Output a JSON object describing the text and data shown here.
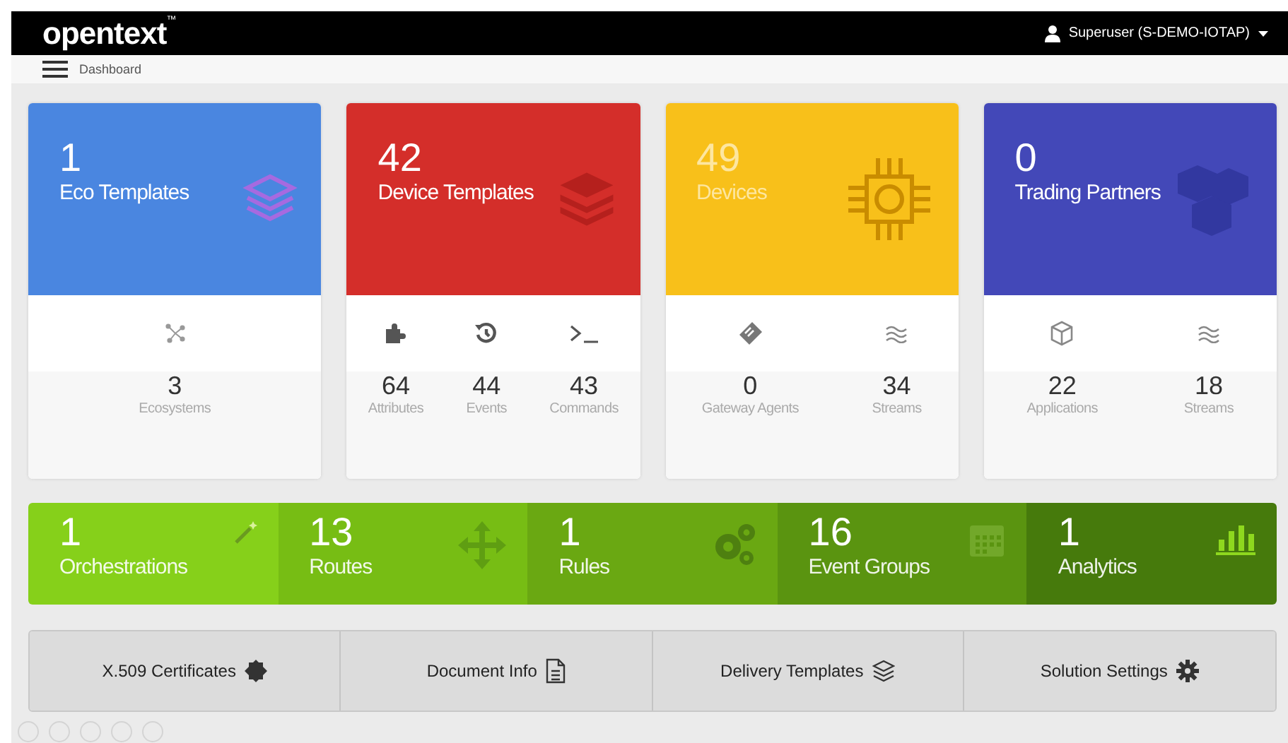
{
  "header": {
    "logo": "opentext",
    "logo_mark": "™",
    "user": "Superuser (S-DEMO-IOTAP)"
  },
  "breadcrumb": "Dashboard",
  "cards": [
    {
      "count": "1",
      "label": "Eco Templates",
      "color": "#4a86e0",
      "stats": [
        {
          "value": "3",
          "label": "Ecosystems"
        }
      ]
    },
    {
      "count": "42",
      "label": "Device Templates",
      "color": "#d42e2a",
      "stats": [
        {
          "value": "64",
          "label": "Attributes"
        },
        {
          "value": "44",
          "label": "Events"
        },
        {
          "value": "43",
          "label": "Commands"
        }
      ]
    },
    {
      "count": "49",
      "label": "Devices",
      "color": "#f8c01a",
      "stats": [
        {
          "value": "0",
          "label": "Gateway Agents"
        },
        {
          "value": "34",
          "label": "Streams"
        }
      ]
    },
    {
      "count": "0",
      "label": "Trading Partners",
      "color": "#4348b8",
      "stats": [
        {
          "value": "22",
          "label": "Applications"
        },
        {
          "value": "18",
          "label": "Streams"
        }
      ]
    }
  ],
  "tiles": [
    {
      "count": "1",
      "label": "Orchestrations",
      "color": "#86d01a"
    },
    {
      "count": "13",
      "label": "Routes",
      "color": "#77bd14"
    },
    {
      "count": "1",
      "label": "Rules",
      "color": "#6aa812"
    },
    {
      "count": "16",
      "label": "Event Groups",
      "color": "#5a9410"
    },
    {
      "count": "1",
      "label": "Analytics",
      "color": "#467a0c"
    }
  ],
  "buttons": [
    {
      "label": "X.509 Certificates"
    },
    {
      "label": "Document Info"
    },
    {
      "label": "Delivery Templates"
    },
    {
      "label": "Solution Settings"
    }
  ]
}
